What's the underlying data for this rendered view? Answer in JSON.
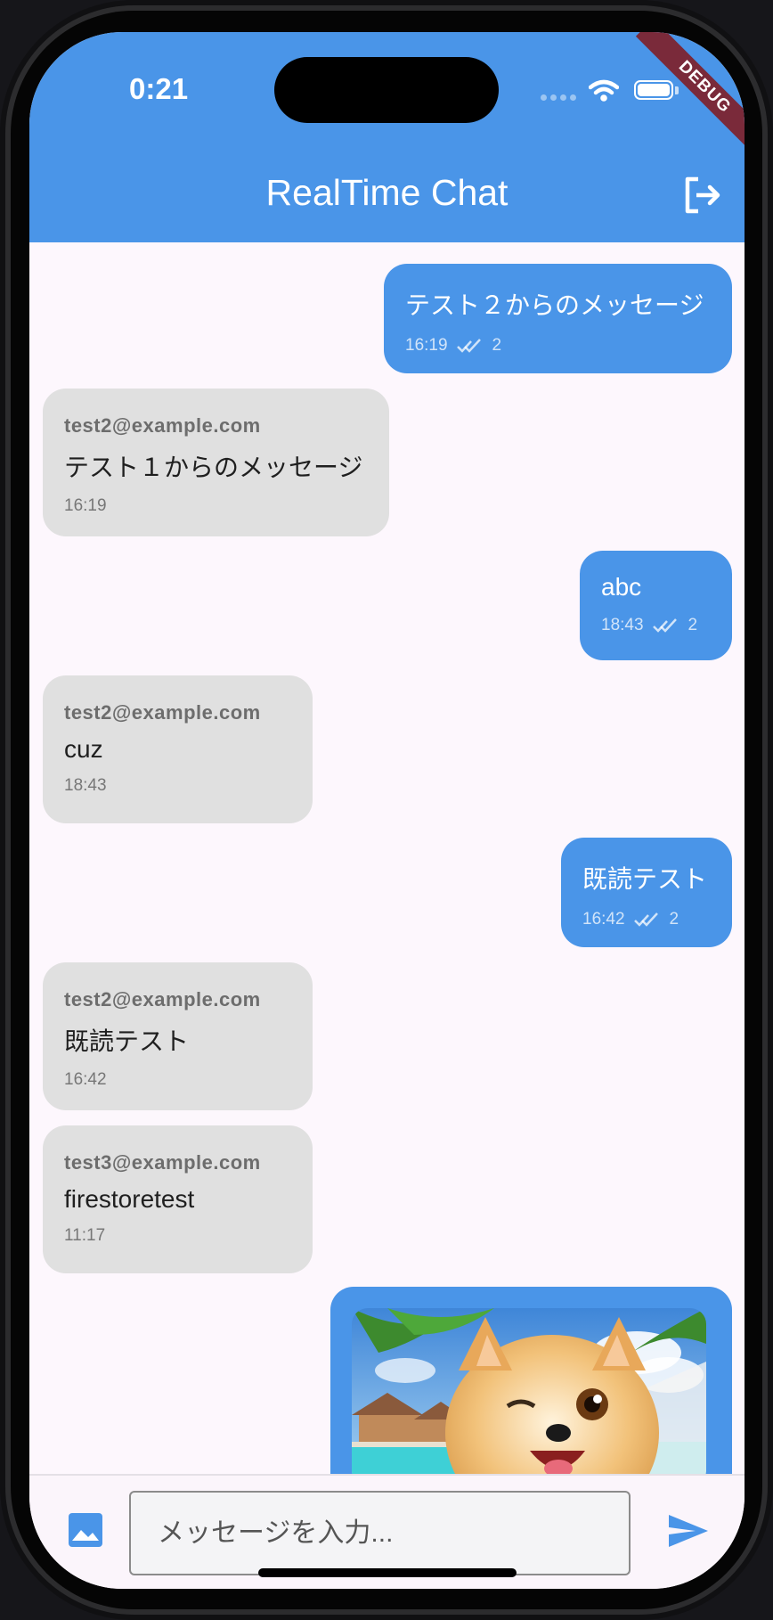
{
  "status_bar": {
    "time": "0:21",
    "debug_label": "DEBUG"
  },
  "app_bar": {
    "title": "RealTime Chat",
    "logout_icon": "logout-icon"
  },
  "messages": [
    {
      "side": "mine",
      "text": "テスト２からのメッセージ",
      "time": "16:19",
      "read_count": "2"
    },
    {
      "side": "theirs",
      "sender": "test2@example.com",
      "text": "テスト１からのメッセージ",
      "time": "16:19"
    },
    {
      "side": "mine",
      "text": "abc",
      "time": "18:43",
      "read_count": "2"
    },
    {
      "side": "theirs",
      "sender": "test2@example.com",
      "text": "cuz",
      "time": "18:43"
    },
    {
      "side": "mine",
      "text": "既読テスト",
      "time": "16:42",
      "read_count": "2"
    },
    {
      "side": "theirs",
      "sender": "test2@example.com",
      "text": "既読テスト",
      "time": "16:42"
    },
    {
      "side": "theirs",
      "sender": "test3@example.com",
      "text": "firestoretest",
      "time": "11:17"
    },
    {
      "side": "mine",
      "type": "image"
    }
  ],
  "input_bar": {
    "placeholder": "メッセージを入力...",
    "image_icon": "image-icon",
    "send_icon": "send-icon"
  },
  "colors": {
    "primary": "#4a95e8",
    "background": "#fdf7fd",
    "incoming_bubble": "#e0e0e0"
  }
}
